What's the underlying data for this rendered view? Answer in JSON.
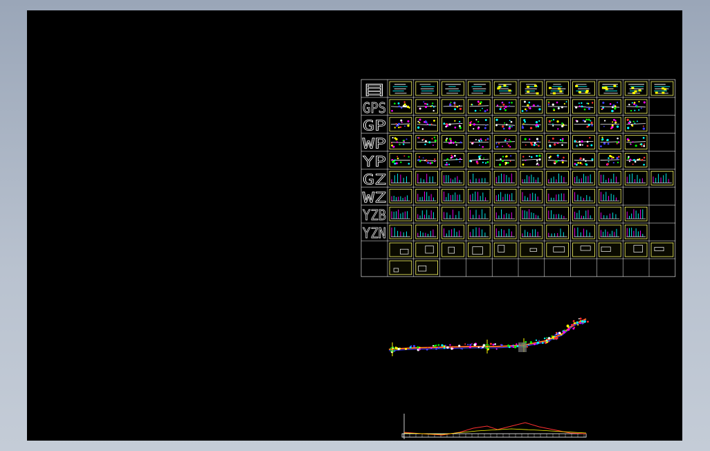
{
  "drawing": {
    "row_labels": [
      "目",
      "GPS",
      "GP",
      "WP",
      "YP",
      "GZ",
      "WZ",
      "YZB",
      "YZN",
      "",
      ""
    ],
    "rows": [
      {
        "key": "mu",
        "count": 11,
        "style": "sheet-title"
      },
      {
        "key": "gps",
        "count": 10,
        "style": "plan"
      },
      {
        "key": "gp",
        "count": 10,
        "style": "plan"
      },
      {
        "key": "wp",
        "count": 10,
        "style": "plan"
      },
      {
        "key": "yp",
        "count": 10,
        "style": "plan"
      },
      {
        "key": "gz",
        "count": 11,
        "style": "section"
      },
      {
        "key": "wz",
        "count": 9,
        "style": "section"
      },
      {
        "key": "yzb",
        "count": 10,
        "style": "section"
      },
      {
        "key": "yzn",
        "count": 10,
        "style": "section"
      },
      {
        "key": "detail1",
        "count": 11,
        "style": "detail"
      },
      {
        "key": "detail2",
        "count": 2,
        "style": "detail"
      }
    ],
    "colors": {
      "background": "#000000",
      "frame": "#ffff66",
      "grid_line": "#ffffff",
      "magenta": "#ff00ff",
      "cyan": "#00ffff",
      "green": "#00ff00",
      "red": "#ff3030",
      "yellow": "#ffff00",
      "blue": "#4040ff"
    }
  }
}
